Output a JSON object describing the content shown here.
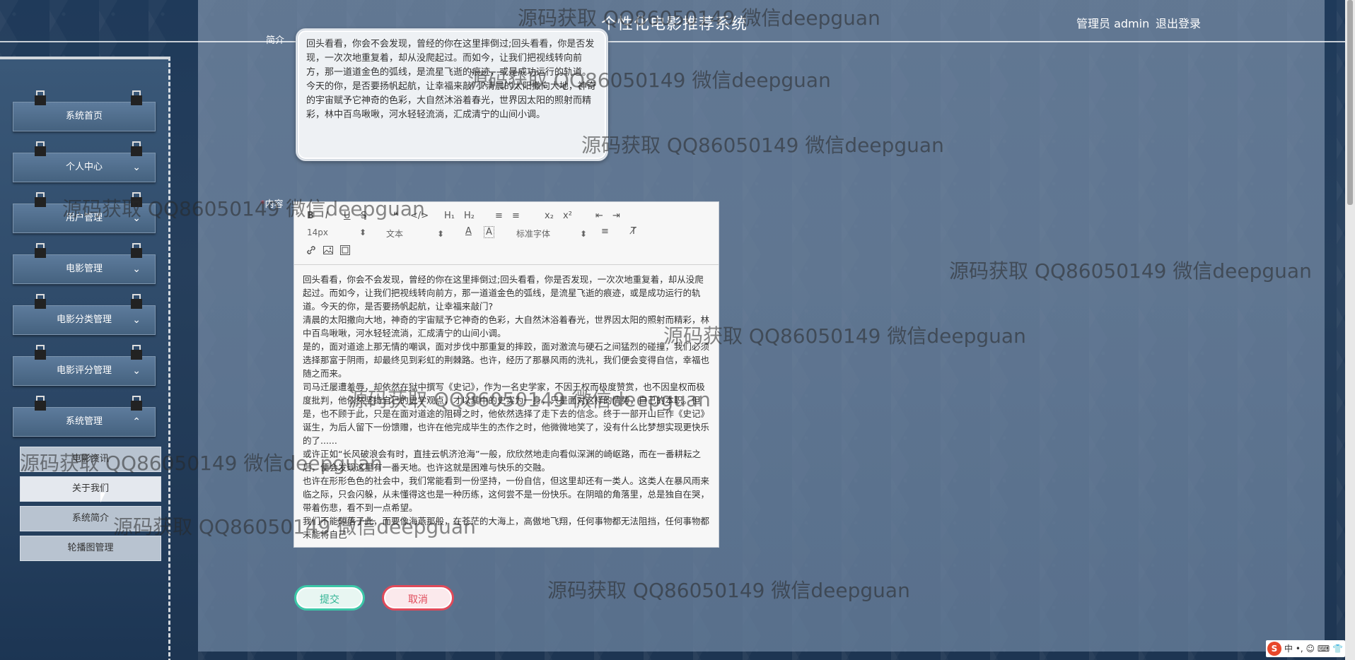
{
  "header": {
    "site_title": "个性化电影推荐系统",
    "admin_label": "管理员 admin",
    "logout_label": "退出登录"
  },
  "sidebar": {
    "items": [
      {
        "label": "系统首页",
        "has_chevron": false
      },
      {
        "label": "个人中心",
        "chevron": "⌄"
      },
      {
        "label": "用户管理",
        "chevron": "⌄"
      },
      {
        "label": "电影管理",
        "chevron": "⌄"
      },
      {
        "label": "电影分类管理",
        "chevron": "⌄"
      },
      {
        "label": "电影评分管理",
        "chevron": "⌄"
      },
      {
        "label": "系统管理",
        "chevron": "⌃"
      }
    ],
    "sub_items": [
      {
        "label": "电影资讯"
      },
      {
        "label": "关于我们"
      },
      {
        "label": "系统简介"
      },
      {
        "label": "轮播图管理"
      }
    ]
  },
  "form": {
    "intro_label": "简介",
    "intro_text": "回头看看，你会不会发现，曾经的你在这里摔倒过;回头看看，你是否发现，一次次地重复着，却从没爬起过。而如今，让我们把视线转向前方，那一道道金色的弧线，是流星飞逝的痕迹，或是成功运行的轨道。今天的你，是否要扬帆起航，让幸福来敲门?清晨的太阳撒向大地，神奇的宇宙赋予它神奇的色彩，大自然沐浴着春光，世界因太阳的照射而精彩，林中百鸟啾啾，河水轻轻流淌，汇成清宁的山间小调。",
    "content_label": "内容",
    "required_mark": "*",
    "toolbar": {
      "row1": [
        "B",
        "I",
        "U",
        "S",
        "❝",
        "</>",
        "H₁",
        "H₂",
        "≡",
        "≡",
        "x₂",
        "x²",
        "⇤",
        "⇥"
      ],
      "font_size": "14px",
      "text_style": "文本",
      "font_color": "A",
      "bg_color": "A",
      "font_family": "标准字体",
      "align": "≡",
      "clear_format": "T̸",
      "row3": [
        "link",
        "image",
        "video"
      ]
    },
    "content_paragraphs": [
      "回头看看，你会不会发现，曾经的你在这里摔倒过;回头看看，你是否发现，一次次地重复着，却从没爬起过。而如今，让我们把视线转向前方，那一道道金色的弧线，是流星飞逝的痕迹，或是成功运行的轨道。今天的你，是否要扬帆起航，让幸福来敲门?",
      "清晨的太阳撒向大地，神奇的宇宙赋予它神奇的色彩，大自然沐浴着春光，世界因太阳的照射而精彩，林中百鸟啾啾，河水轻轻流淌，汇成清宁的山间小调。",
      "是的，面对道途上那无情的嘲讽，面对步伐中那重复的摔跤，面对激流与硬石之间猛烈的碰撞，我们必须选择那富于阴雨，却最终见到彩虹的荆棘路。也许，经历了那暴风雨的洗礼，我们便会变得自信，幸福也随之而来。",
      "司马迁屡遭羞辱，却依然在狱中撰写《史记》，作为一名史学家，不因王权而极度赞赏，也不因皇权而极度批判，他依然坚持自己的史学观点，才以其中的史实为一身，只是面对这样的情势，自己的本职。但是，也不顾于此，只是在面对道途的阻碍之时，他依然选择了走下去的信念。终于一部开山巨作《史记》诞生，为后人留下一份馈赠，也许在他完成毕生的杰作之时，他微微地笑了，没有什么比梦想实现更快乐的了......",
      "或许正如“长风破浪会有时，直挂云帆济沧海”一般，欣欣然地走向看似深渊的崎岖路，而在一番耕耘之后，便会发现这里有一番天地。也许这就是困难与快乐的交融。",
      "也许在形形色色的社会中，我们常能看到一份坚持，一份自信，但这里却还有一类人。这类人在暴风雨来临之际，只会闪躲，从未懂得这也是一种历练，这何尝不是一份快乐。在阴暗的角落里，总是独自在哭，带着伤悲，看不到一点希望。",
      "我们不能晾落于此，而要像海燕那般，在苍茫的大海上，高傲地飞翔，任何事物都无法阻挡，任何事物都未能将自己",
      "......"
    ],
    "submit_label": "提交",
    "cancel_label": "取消"
  },
  "watermark_text": "源码获取 QQ86050149 微信deepguan",
  "ime": {
    "logo": "S",
    "text": "中 •, ☺ ⌨ 👕 ⋮⋮"
  }
}
